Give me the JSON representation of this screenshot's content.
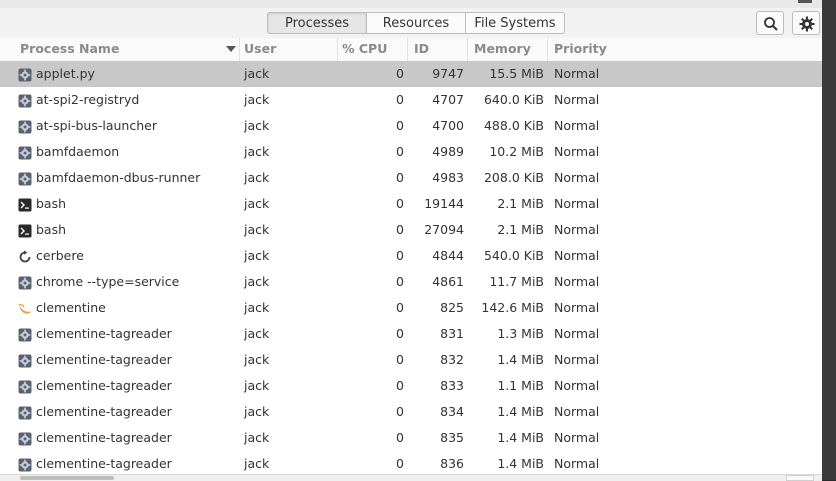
{
  "toolbar": {
    "tabs": [
      {
        "label": "Processes",
        "active": true
      },
      {
        "label": "Resources",
        "active": false
      },
      {
        "label": "File Systems",
        "active": false
      }
    ],
    "search_icon": "search-icon",
    "settings_icon": "gear-icon"
  },
  "columns": {
    "name": "Process Name",
    "user": "User",
    "cpu": "% CPU",
    "id": "ID",
    "memory": "Memory",
    "priority": "Priority"
  },
  "colors": {
    "selected_row": "#c8c8c8",
    "header_text": "#8a8a8a",
    "clementine_icon": "#f0a040"
  },
  "processes": [
    {
      "name": "applet.py",
      "user": "jack",
      "cpu": "0",
      "id": "9747",
      "memory": "15.5 MiB",
      "priority": "Normal",
      "icon": "gear",
      "selected": true
    },
    {
      "name": "at-spi2-registryd",
      "user": "jack",
      "cpu": "0",
      "id": "4707",
      "memory": "640.0 KiB",
      "priority": "Normal",
      "icon": "gear"
    },
    {
      "name": "at-spi-bus-launcher",
      "user": "jack",
      "cpu": "0",
      "id": "4700",
      "memory": "488.0 KiB",
      "priority": "Normal",
      "icon": "gear"
    },
    {
      "name": "bamfdaemon",
      "user": "jack",
      "cpu": "0",
      "id": "4989",
      "memory": "10.2 MiB",
      "priority": "Normal",
      "icon": "gear"
    },
    {
      "name": "bamfdaemon-dbus-runner",
      "user": "jack",
      "cpu": "0",
      "id": "4983",
      "memory": "208.0 KiB",
      "priority": "Normal",
      "icon": "gear"
    },
    {
      "name": "bash",
      "user": "jack",
      "cpu": "0",
      "id": "19144",
      "memory": "2.1 MiB",
      "priority": "Normal",
      "icon": "terminal"
    },
    {
      "name": "bash",
      "user": "jack",
      "cpu": "0",
      "id": "27094",
      "memory": "2.1 MiB",
      "priority": "Normal",
      "icon": "terminal"
    },
    {
      "name": "cerbere",
      "user": "jack",
      "cpu": "0",
      "id": "4844",
      "memory": "540.0 KiB",
      "priority": "Normal",
      "icon": "refresh"
    },
    {
      "name": "chrome --type=service",
      "user": "jack",
      "cpu": "0",
      "id": "4861",
      "memory": "11.7 MiB",
      "priority": "Normal",
      "icon": "gear"
    },
    {
      "name": "clementine",
      "user": "jack",
      "cpu": "0",
      "id": "825",
      "memory": "142.6 MiB",
      "priority": "Normal",
      "icon": "clementine"
    },
    {
      "name": "clementine-tagreader",
      "user": "jack",
      "cpu": "0",
      "id": "831",
      "memory": "1.3 MiB",
      "priority": "Normal",
      "icon": "gear"
    },
    {
      "name": "clementine-tagreader",
      "user": "jack",
      "cpu": "0",
      "id": "832",
      "memory": "1.4 MiB",
      "priority": "Normal",
      "icon": "gear"
    },
    {
      "name": "clementine-tagreader",
      "user": "jack",
      "cpu": "0",
      "id": "833",
      "memory": "1.1 MiB",
      "priority": "Normal",
      "icon": "gear"
    },
    {
      "name": "clementine-tagreader",
      "user": "jack",
      "cpu": "0",
      "id": "834",
      "memory": "1.4 MiB",
      "priority": "Normal",
      "icon": "gear"
    },
    {
      "name": "clementine-tagreader",
      "user": "jack",
      "cpu": "0",
      "id": "835",
      "memory": "1.4 MiB",
      "priority": "Normal",
      "icon": "gear"
    },
    {
      "name": "clementine-tagreader",
      "user": "jack",
      "cpu": "0",
      "id": "836",
      "memory": "1.4 MiB",
      "priority": "Normal",
      "icon": "gear"
    }
  ]
}
